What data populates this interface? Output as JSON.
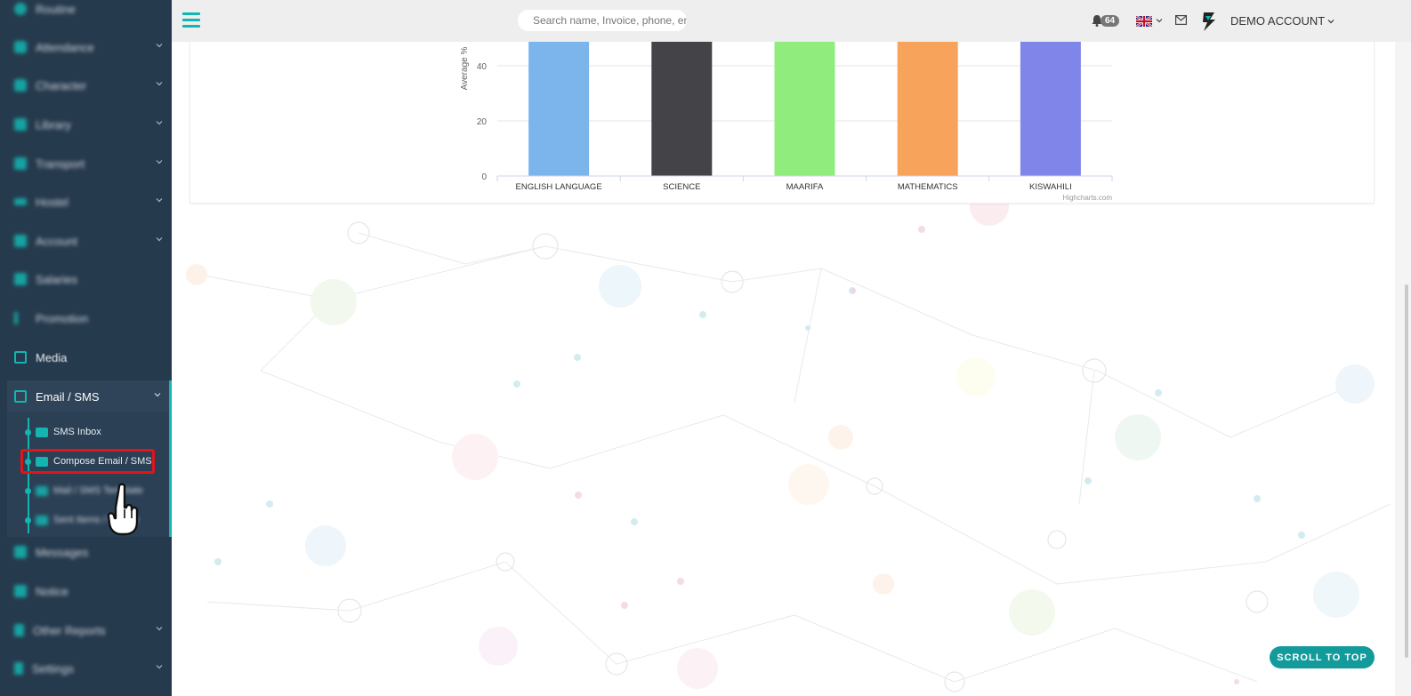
{
  "topbar": {
    "search_placeholder": "Search name, Invoice, phone, email",
    "notification_count": "64",
    "account_label": "DEMO ACCOUNT"
  },
  "sidebar": {
    "items": [
      {
        "label": "Routine",
        "expandable": false
      },
      {
        "label": "Attendance",
        "expandable": true
      },
      {
        "label": "Character",
        "expandable": true
      },
      {
        "label": "Library",
        "expandable": true
      },
      {
        "label": "Transport",
        "expandable": true
      },
      {
        "label": "Hostel",
        "expandable": true
      },
      {
        "label": "Account",
        "expandable": true
      },
      {
        "label": "Salaries",
        "expandable": false
      },
      {
        "label": "Promotion",
        "expandable": false
      },
      {
        "label": "Media",
        "expandable": false
      },
      {
        "label": "Email / SMS",
        "expandable": true,
        "active": true
      },
      {
        "label": "Messages",
        "expandable": false
      },
      {
        "label": "Notice",
        "expandable": false
      },
      {
        "label": "Other Reports",
        "expandable": true
      },
      {
        "label": "Settings",
        "expandable": true
      }
    ],
    "email_sms_subitems": [
      {
        "label": "SMS Inbox"
      },
      {
        "label": "Compose Email / SMS",
        "highlighted": true
      },
      {
        "label": "Mail / SMS Template"
      },
      {
        "label": "Sent Items / History"
      }
    ]
  },
  "chart_data": {
    "type": "bar",
    "categories": [
      "ENGLISH LANGUAGE",
      "SCIENCE",
      "MAARIFA",
      "MATHEMATICS",
      "KISWAHILI"
    ],
    "colors": [
      "#7cb5ec",
      "#434348",
      "#90ed7d",
      "#f7a35c",
      "#8085e9"
    ],
    "values": [
      65,
      65,
      65,
      65,
      65
    ],
    "ylabel": "Average %",
    "yticks": [
      0,
      20,
      40
    ],
    "credit": "Highcharts.com"
  },
  "scroll_top_label": "SCROLL TO TOP"
}
